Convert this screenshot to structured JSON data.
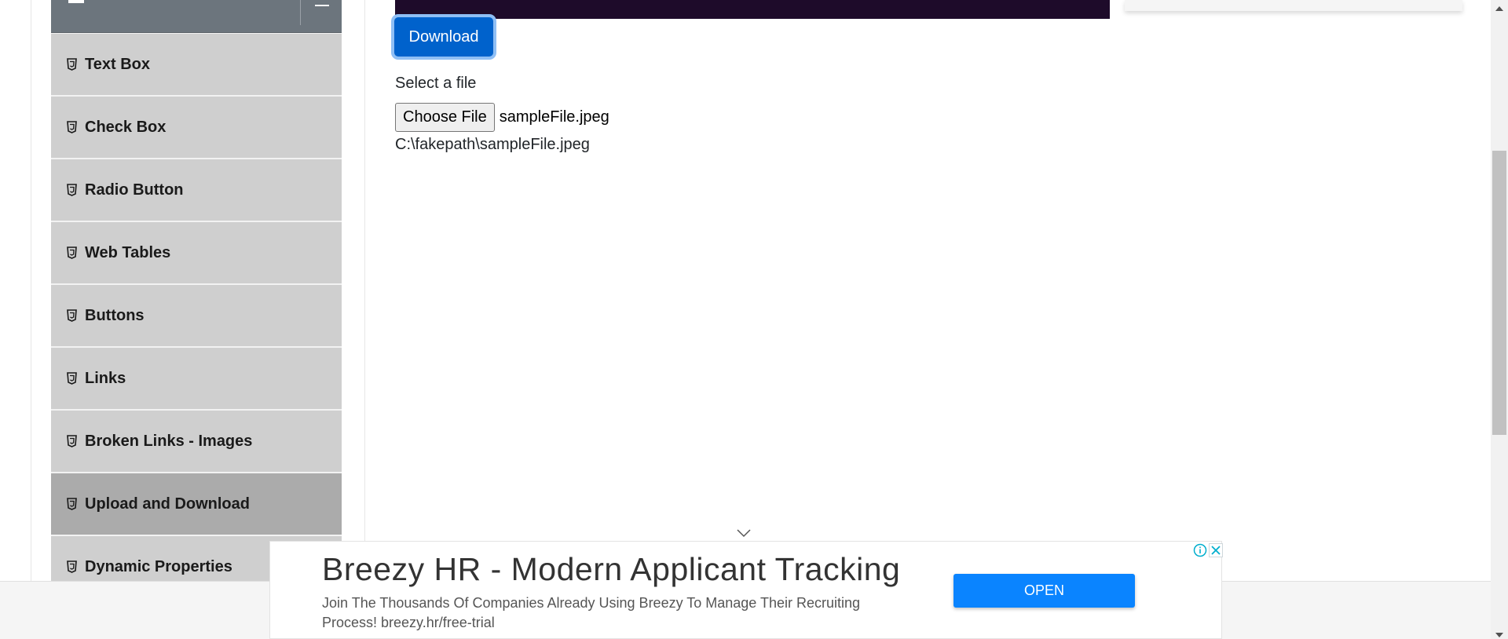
{
  "sidebar": {
    "items": [
      {
        "label": "Text Box",
        "active": false
      },
      {
        "label": "Check Box",
        "active": false
      },
      {
        "label": "Radio Button",
        "active": false
      },
      {
        "label": "Web Tables",
        "active": false
      },
      {
        "label": "Buttons",
        "active": false
      },
      {
        "label": "Links",
        "active": false
      },
      {
        "label": "Broken Links - Images",
        "active": false
      },
      {
        "label": "Upload and Download",
        "active": true
      },
      {
        "label": "Dynamic Properties",
        "active": false
      }
    ],
    "item_icon": "html5-icon",
    "colors": {
      "item_bg": "#cfcfcf",
      "active_bg": "#ababab",
      "header_bg": "#6c757d"
    }
  },
  "main": {
    "download_label": "Download",
    "select_label": "Select a file",
    "choose_file_label": "Choose File",
    "selected_file_name": "sampleFile.jpeg",
    "uploaded_path": "C:\\fakepath\\sampleFile.jpeg",
    "colors": {
      "download_bg": "#0062cc"
    }
  },
  "ad": {
    "title": "Breezy HR - Modern Applicant Tracking",
    "description": "Join The Thousands Of Companies Already Using Breezy To Manage Their Recruiting Process! breezy.hr/free-trial",
    "cta_label": "OPEN",
    "colors": {
      "cta_bg": "#0a84ff"
    }
  }
}
